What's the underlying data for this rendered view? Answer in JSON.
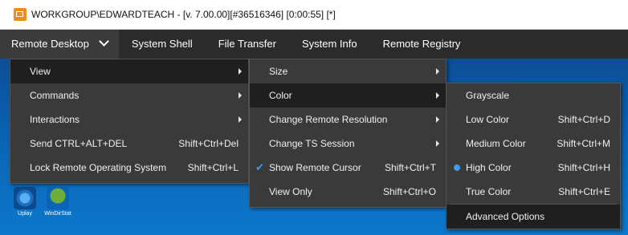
{
  "window": {
    "title": "WORKGROUP\\EDWARDTEACH -  [v. 7.00.00][#36516346] [0:00:55] [*]"
  },
  "menubar": {
    "items": [
      {
        "label": "Remote Desktop"
      },
      {
        "label": "System Shell"
      },
      {
        "label": "File Transfer"
      },
      {
        "label": "System Info"
      },
      {
        "label": "Remote Registry"
      }
    ]
  },
  "desktop": {
    "icons": [
      {
        "label": "Uplay",
        "icon": "uplay-icon"
      },
      {
        "label": "WinDirStat",
        "icon": "windirstat-icon"
      }
    ]
  },
  "menu1": {
    "items": [
      {
        "label": "View",
        "shortcut": ""
      },
      {
        "label": "Commands",
        "shortcut": ""
      },
      {
        "label": "Interactions",
        "shortcut": ""
      },
      {
        "label": "Send CTRL+ALT+DEL",
        "shortcut": "Shift+Ctrl+Del"
      },
      {
        "label": "Lock Remote Operating System",
        "shortcut": "Shift+Ctrl+L"
      }
    ]
  },
  "menu2": {
    "items": [
      {
        "label": "Size",
        "shortcut": ""
      },
      {
        "label": "Color",
        "shortcut": ""
      },
      {
        "label": "Change Remote Resolution",
        "shortcut": ""
      },
      {
        "label": "Change TS Session",
        "shortcut": ""
      },
      {
        "label": "Show Remote Cursor",
        "shortcut": "Shift+Ctrl+T",
        "checked": true
      },
      {
        "label": "View Only",
        "shortcut": "Shift+Ctrl+O"
      }
    ]
  },
  "menu3": {
    "items": [
      {
        "label": "Grayscale",
        "shortcut": ""
      },
      {
        "label": "Low Color",
        "shortcut": "Shift+Ctrl+D"
      },
      {
        "label": "Medium Color",
        "shortcut": "Shift+Ctrl+M"
      },
      {
        "label": "High Color",
        "shortcut": "Shift+Ctrl+H",
        "selected": true
      },
      {
        "label": "True Color",
        "shortcut": "Shift+Ctrl+E"
      },
      {
        "label": "Advanced Options",
        "shortcut": ""
      }
    ]
  },
  "colors": {
    "accent": "#3d9bf0",
    "menu_bg": "#3a3a3a",
    "menubar_bg": "#2b2b2b",
    "highlight": "#1f1f1f",
    "brand": "#f28c12"
  }
}
